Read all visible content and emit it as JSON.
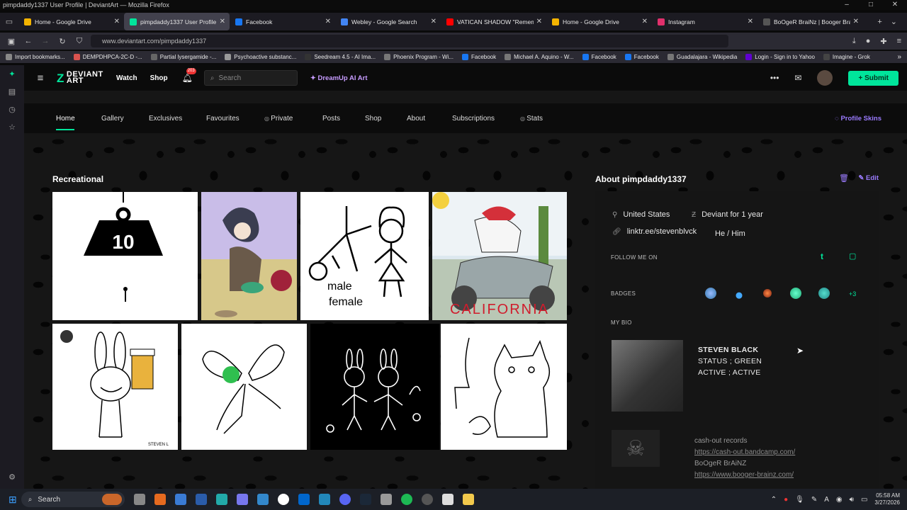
{
  "window": {
    "title": "pimpdaddy1337 User Profile | DeviantArt — Mozilla Firefox"
  },
  "browser": {
    "tabs": [
      {
        "label": "Home - Google Drive",
        "color": "#f4b400"
      },
      {
        "label": "pimpdaddy1337 User Profile | D",
        "color": "#00e59b",
        "active": true
      },
      {
        "label": "Facebook",
        "color": "#1877f2"
      },
      {
        "label": "Webley - Google Search",
        "color": "#4285f4"
      },
      {
        "label": "VATICAN SHADOW \"Remembe",
        "color": "#ff0000"
      },
      {
        "label": "Home - Google Drive",
        "color": "#f4b400"
      },
      {
        "label": "Instagram",
        "color": "#e1306c"
      },
      {
        "label": "BoOgeR BraiNz | Booger Brainz",
        "color": "#555555"
      }
    ],
    "url": "www.deviantart.com/pimpdaddy1337",
    "bookmarks": [
      {
        "label": "Import bookmarks...",
        "color": "#888888"
      },
      {
        "label": "DEMPDHPCA-2C-D -...",
        "color": "#d9534f"
      },
      {
        "label": "Partial lysergamide -...",
        "color": "#666666"
      },
      {
        "label": "Psychoactive substanc...",
        "color": "#999999"
      },
      {
        "label": "Seedream 4.5 - AI Ima...",
        "color": "#333333"
      },
      {
        "label": "Phoenix Program - Wi...",
        "color": "#777777"
      },
      {
        "label": "Facebook",
        "color": "#1877f2"
      },
      {
        "label": "Michael A. Aquino - W...",
        "color": "#777777"
      },
      {
        "label": "Facebook",
        "color": "#1877f2"
      },
      {
        "label": "Facebook",
        "color": "#1877f2"
      },
      {
        "label": "Guadalajara - Wikipedia",
        "color": "#777777"
      },
      {
        "label": "Login - Sign in to Yahoo",
        "color": "#6001d2"
      },
      {
        "label": "Imagine - Grok",
        "color": "#444444"
      }
    ]
  },
  "da": {
    "logo_line1": "DEVIANT",
    "logo_line2": "ART",
    "watch": "Watch",
    "shop": "Shop",
    "notif_count": "203",
    "search_placeholder": "Search",
    "dreamup": "DreamUp AI Art",
    "submit": "Submit",
    "accent": "#00e59b"
  },
  "subnav": {
    "items": [
      "Home",
      "Gallery",
      "Exclusives",
      "Favourites",
      "Private",
      "Posts",
      "Shop",
      "About",
      "Subscriptions",
      "Stats"
    ],
    "profile_skins": "Profile Skins"
  },
  "gallery": {
    "title": "Recreational",
    "thumb1_text": "10",
    "thumb3_text1": "male",
    "thumb3_text2": "female",
    "thumb4_text": "CALIFORNIA",
    "thumb5_text": "STEVEN L"
  },
  "about": {
    "title": "About pimpdaddy1337",
    "edit": "Edit",
    "country": "United States",
    "deviant_for": "Deviant for 1 year",
    "link": "linktr.ee/stevenblvck",
    "pronouns": "He / Him",
    "follow_label": "FOLLOW ME ON",
    "badges_label": "BADGES",
    "badges_more": "+3",
    "bio_label": "MY BIO",
    "bio_name": "STEVEN BLACK",
    "bio_status": "STATUS ; GREEN",
    "bio_active": "ACTIVE ; ACTIVE",
    "cash_label": "cash-out records",
    "cash_link": "https://cash-out.bandcamp.com/",
    "booger_label": "BoOgeR BrAiNZ",
    "booger_link": "https://www.booger-brainz.com/"
  },
  "taskbar": {
    "search": "Search",
    "time": "05:58 AM",
    "date": "3/27/2026"
  }
}
